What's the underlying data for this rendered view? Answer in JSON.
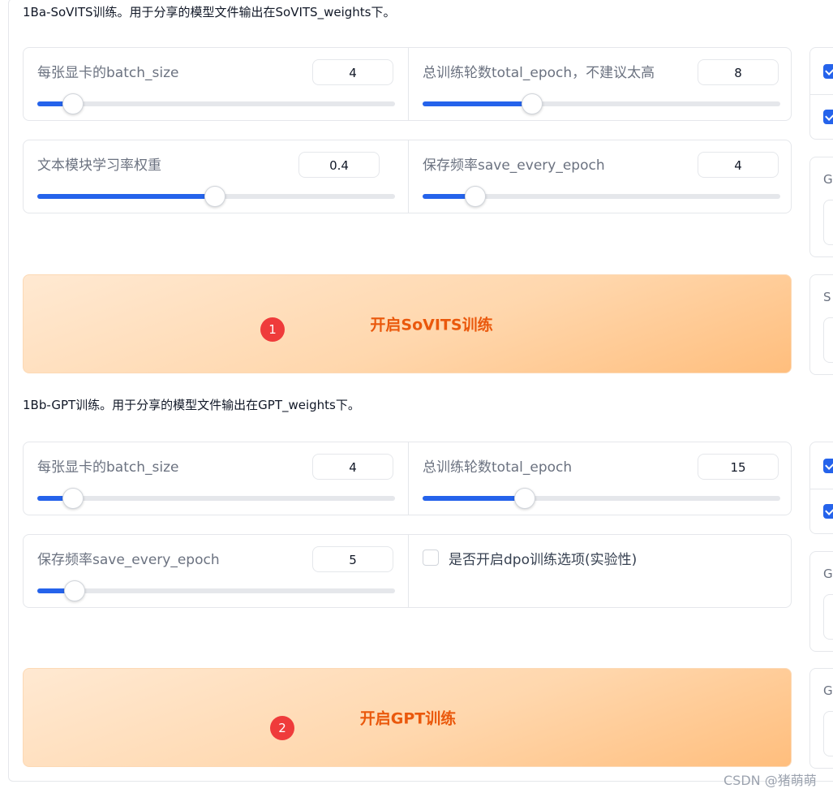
{
  "sovits": {
    "title": "1Ba-SoVITS训练。用于分享的模型文件输出在SoVITS_weights下。",
    "batch_size": {
      "label": "每张显卡的batch_size",
      "value": "4",
      "level": 0.1
    },
    "total_epoch": {
      "label": "总训练轮数total_epoch，不建议太高",
      "value": "8",
      "level": 0.305
    },
    "text_lr": {
      "label": "文本模块学习率权重",
      "value": "0.4",
      "level": 0.497
    },
    "save_every": {
      "label": "保存频率save_every_epoch",
      "value": "4",
      "level": 0.147
    },
    "button_label": "开启SoVITS训练",
    "badge": "1"
  },
  "gpt": {
    "title": "1Bb-GPT训练。用于分享的模型文件输出在GPT_weights下。",
    "batch_size": {
      "label": "每张显卡的batch_size",
      "value": "4",
      "level": 0.1
    },
    "total_epoch": {
      "label": "总训练轮数total_epoch",
      "value": "15",
      "level": 0.285
    },
    "save_every": {
      "label": "保存频率save_every_epoch",
      "value": "5",
      "level": 0.105
    },
    "dpo_label": "是否开启dpo训练选项(实验性)",
    "dpo_checked": false,
    "button_label": "开启GPT训练",
    "badge": "2"
  },
  "side": {
    "g1": "G",
    "s": "S",
    "g2": "G",
    "g3": "G"
  },
  "watermark": "CSDN @猪萌萌",
  "colors": {
    "accent": "#2563eb",
    "button_text": "#ea580c",
    "badge": "#ef3b3b"
  }
}
